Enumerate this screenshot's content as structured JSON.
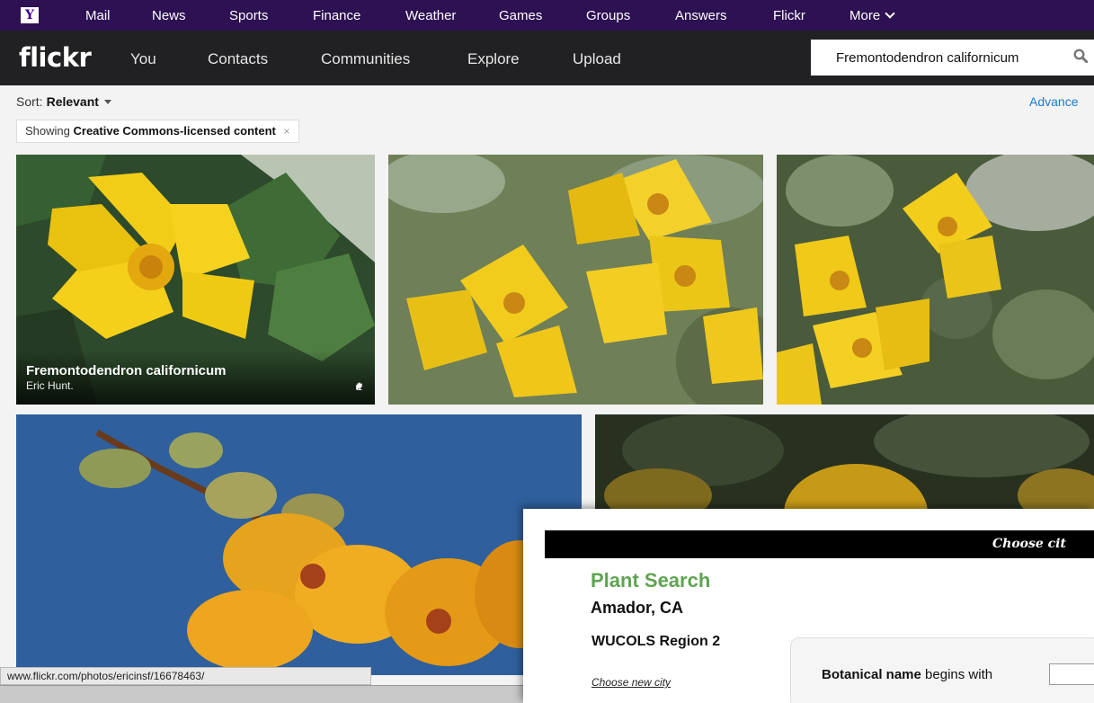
{
  "yahoo_bar": {
    "logo": "Y",
    "links": [
      "Mail",
      "News",
      "Sports",
      "Finance",
      "Weather",
      "Games",
      "Groups",
      "Answers",
      "Flickr",
      "More"
    ]
  },
  "flickr_bar": {
    "logo": "flickr",
    "nav": [
      "You",
      "Contacts",
      "Communities",
      "Explore",
      "Upload"
    ],
    "search_value": "Fremontodendron californicum",
    "search_icon": "magnifier-icon"
  },
  "toolbar": {
    "sort_label": "Sort:",
    "sort_value": "Relevant",
    "advanced": "Advance",
    "filter_prefix": "Showing",
    "filter_bold": "Creative Commons-licensed content",
    "filter_close": "×"
  },
  "photos": [
    {
      "title": "Fremontodendron californicum",
      "author": "Eric Hunt.",
      "comments": "1"
    }
  ],
  "status_url": "www.flickr.com/photos/ericinsf/16678463/",
  "plant_window": {
    "header": "Choose cit",
    "title": "Plant Search",
    "city": "Amador, CA",
    "region": "WUCOLS Region 2",
    "choose_city": "Choose new city",
    "botanical_bold": "Botanical name",
    "botanical_rest": " begins with"
  },
  "colors": {
    "yahoo_purple": "#2d1152",
    "flickr_dark": "#212124",
    "link_blue": "#1a79d6",
    "plant_green": "#5fa451"
  }
}
